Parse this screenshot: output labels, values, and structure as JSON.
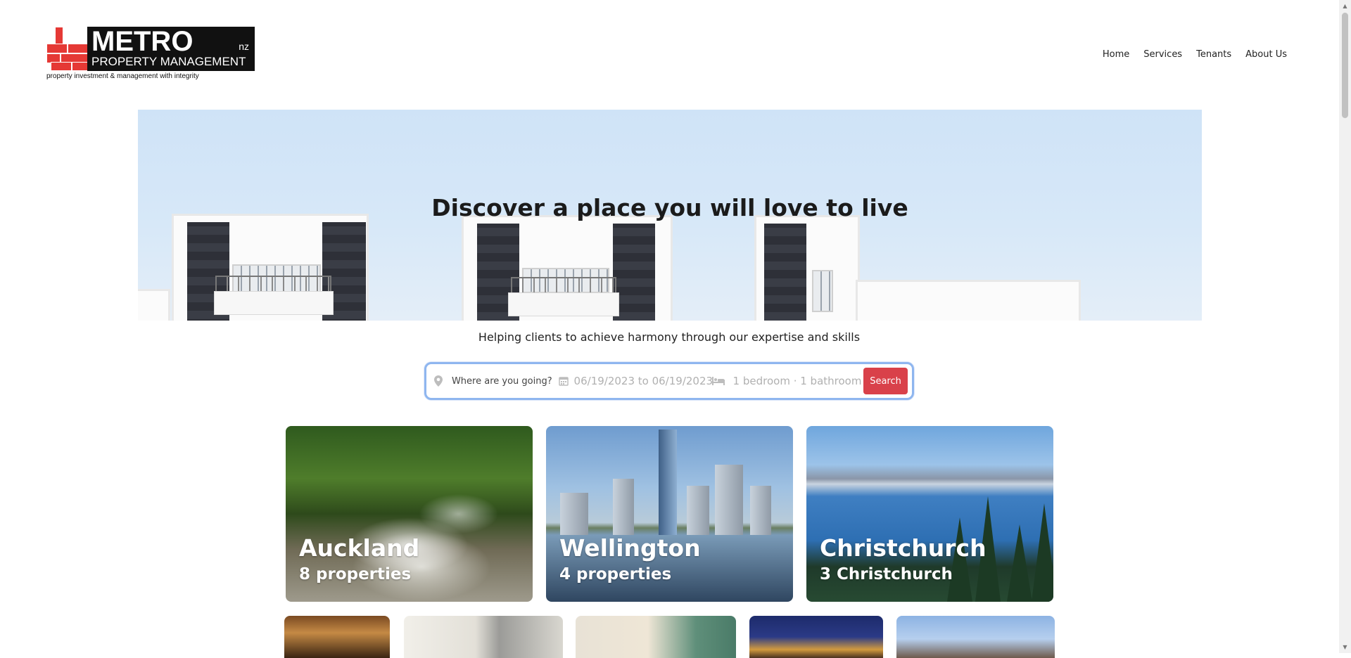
{
  "header": {
    "logo": {
      "word": "METRO",
      "suffix": "nz",
      "subtitle": "PROPERTY MANAGEMENT",
      "tagline": "property investment & management with integrity"
    },
    "nav": [
      {
        "label": "Home"
      },
      {
        "label": "Services"
      },
      {
        "label": "Tenants"
      },
      {
        "label": "About Us"
      }
    ]
  },
  "hero": {
    "title": "Discover a place you will love to live",
    "subtitle": "Helping clients to achieve harmony through our expertise and skills"
  },
  "search": {
    "where_placeholder": "Where are you going?",
    "dates": "06/19/2023 to 06/19/2023",
    "guests": "1 bedroom · 1 bathroom",
    "button_label": "Search",
    "icons": {
      "where": "map-pin-icon",
      "dates": "calendar-icon",
      "guests": "bed-icon"
    },
    "accent_color": "#d9414a",
    "border_color": "#8fb6ef"
  },
  "cities": [
    {
      "name": "Auckland",
      "count": "8 properties"
    },
    {
      "name": "Wellington",
      "count": "4 properties"
    },
    {
      "name": "Christchurch",
      "count": "3 Christchurch"
    }
  ]
}
